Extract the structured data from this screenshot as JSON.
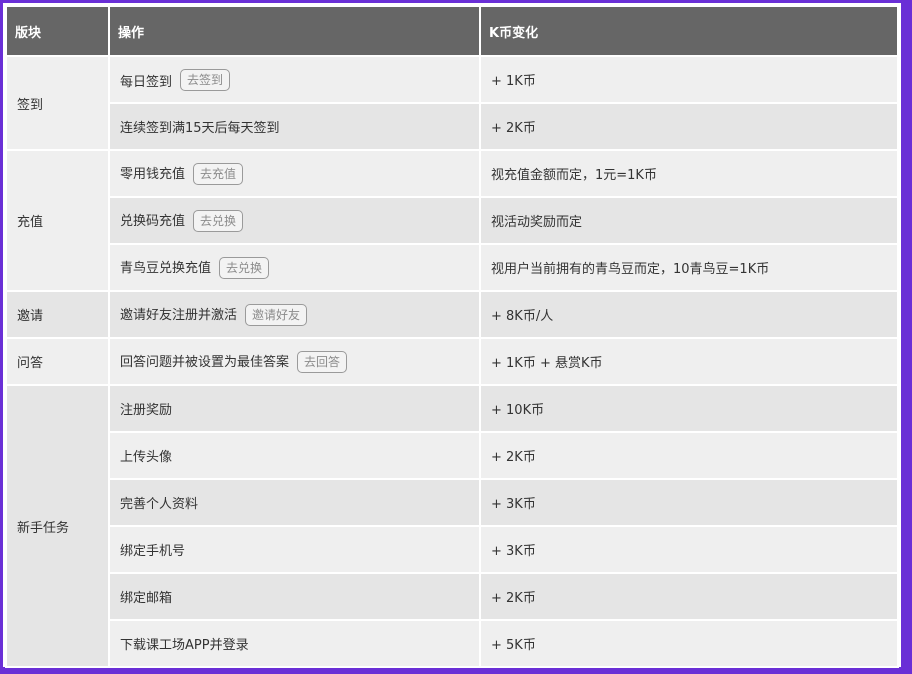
{
  "headers": {
    "section": "版块",
    "action": "操作",
    "change": "K币变化"
  },
  "sections": {
    "signin": "签到",
    "recharge": "充值",
    "invite": "邀请",
    "qa": "问答",
    "newbie": "新手任务"
  },
  "rows": [
    {
      "action": "每日签到",
      "button": "去签到",
      "change": "+ 1K币"
    },
    {
      "action": "连续签到满15天后每天签到",
      "change": "+ 2K币"
    },
    {
      "action": "零用钱充值",
      "button": "去充值",
      "change": "视充值金额而定，1元=1K币"
    },
    {
      "action": "兑换码充值",
      "button": "去兑换",
      "change": "视活动奖励而定"
    },
    {
      "action": "青鸟豆兑换充值",
      "button": "去兑换",
      "change": "视用户当前拥有的青鸟豆而定，10青鸟豆=1K币"
    },
    {
      "action": "邀请好友注册并激活",
      "button": "邀请好友",
      "change": "+ 8K币/人"
    },
    {
      "action": "回答问题并被设置为最佳答案",
      "button": "去回答",
      "change": "+ 1K币 + 悬赏K币"
    },
    {
      "action": "注册奖励",
      "change": "+ 10K币"
    },
    {
      "action": "上传头像",
      "change": "+ 2K币"
    },
    {
      "action": "完善个人资料",
      "change": "+ 3K币"
    },
    {
      "action": "绑定手机号",
      "change": "+ 3K币"
    },
    {
      "action": "绑定邮箱",
      "change": "+ 2K币"
    },
    {
      "action": "下载课工场APP并登录",
      "change": "+ 5K币"
    }
  ],
  "colors": {
    "page_bg": "#6a2fd6",
    "header_bg": "#666666",
    "row_light": "#efefef",
    "row_dark": "#e5e5e5"
  }
}
